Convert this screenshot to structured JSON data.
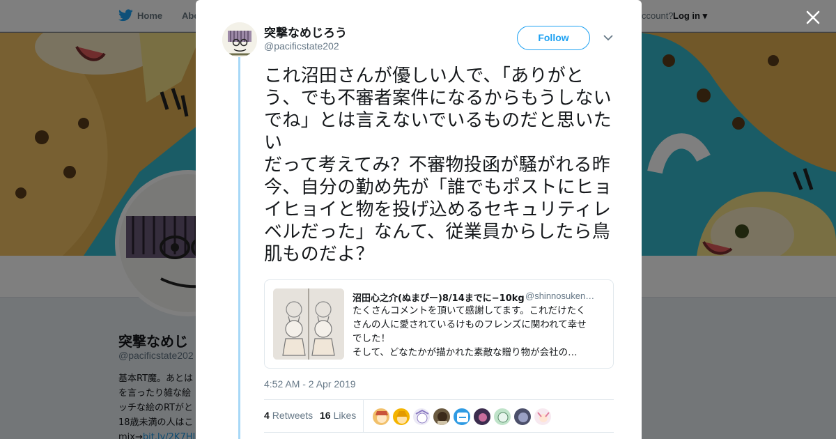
{
  "nav": {
    "home": "Home",
    "about": "Abo",
    "account_prompt": "ccount?",
    "login": "Log in"
  },
  "profile": {
    "name": "突撃なめじ",
    "handle": "@pacificstate202",
    "bio_lines": [
      "基本RT魔。あとは",
      "を言ったり雑な絵",
      "ッチな絵のRTがと",
      "18歳未満の人はこ"
    ],
    "bio_link_prefix": "mix→",
    "bio_link": "bit.ly/2K7HJ"
  },
  "tweet": {
    "display_name": "突撃なめじろう",
    "screen_name": "@pacificstate202",
    "follow_label": "Follow",
    "text": "これ沼田さんが優しい人で、「ありがとう、でも不審者案件になるからもうしないでね」とは言えないでいるものだと思いたい\nだって考えてみ？不審物投函が騒がれる昨今、自分の勤め先が「誰でもポストにヒョイヒョイと物を投げ込めるセキュリティレベルだった」なんて、従業員からしたら鳥肌ものだよ？",
    "quote": {
      "name": "沼田心之介(ぬまぴー)8/14までに−10kg",
      "handle": "@shinnosuken…",
      "lines": [
        "たくさんコメントを頂いて感謝してます。これだけたく",
        "さんの人に愛されているけものフレンズに関われて幸せ",
        "でした！",
        "そして、どなたかが描かれた素敵な贈り物が会社の…"
      ]
    },
    "timestamp": "4:52 AM - 2 Apr 2019",
    "retweets_count": "4",
    "retweets_label": "Retweets",
    "likes_count": "16",
    "likes_label": "Likes"
  },
  "icons": {
    "close": "close-icon",
    "caret": "chevron-down-icon",
    "twitter": "twitter-bird-icon"
  },
  "colors": {
    "accent": "#1da1f2",
    "thread_line": "#a7d8f7",
    "banner": "#35b8cc"
  }
}
